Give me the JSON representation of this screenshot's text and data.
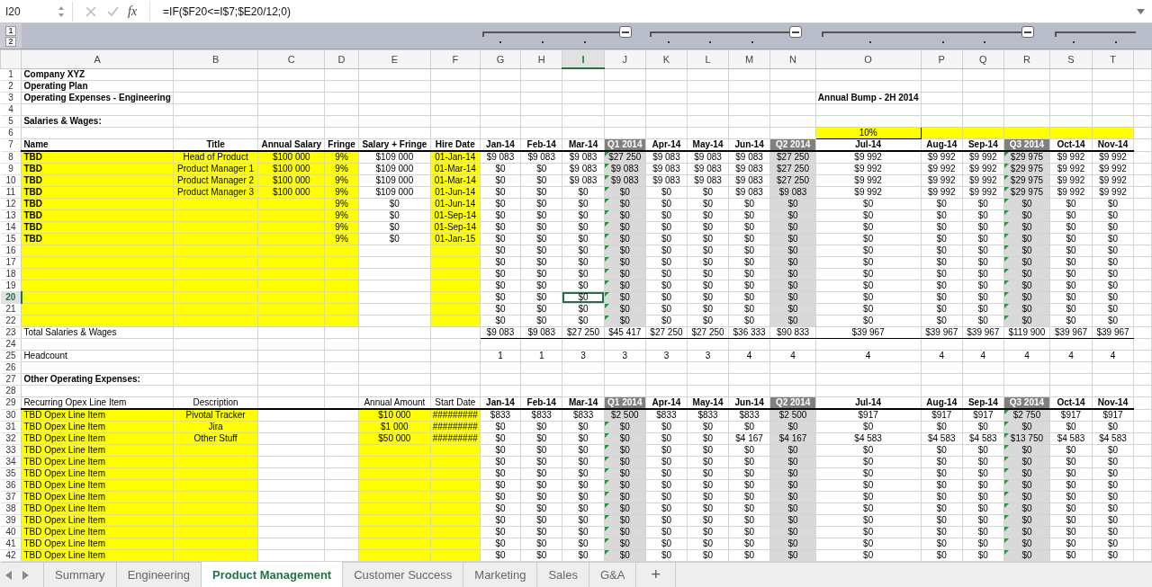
{
  "formula_bar": {
    "name_box": "I20",
    "fx": "fx",
    "formula": "=IF($F20<=I$7;$E20/12;0)"
  },
  "outline_levels": [
    "1",
    "2"
  ],
  "columns": [
    {
      "letter": "A",
      "kind": "label",
      "selected": false
    },
    {
      "letter": "B",
      "kind": "text",
      "selected": false
    },
    {
      "letter": "C",
      "kind": "text",
      "selected": false
    },
    {
      "letter": "D",
      "kind": "text",
      "selected": false
    },
    {
      "letter": "E",
      "kind": "text",
      "selected": false
    },
    {
      "letter": "F",
      "kind": "text",
      "selected": false
    },
    {
      "letter": "G",
      "kind": "month",
      "selected": false
    },
    {
      "letter": "H",
      "kind": "month",
      "selected": false
    },
    {
      "letter": "I",
      "kind": "month",
      "selected": true
    },
    {
      "letter": "J",
      "kind": "quarter",
      "selected": false
    },
    {
      "letter": "K",
      "kind": "month",
      "selected": false
    },
    {
      "letter": "L",
      "kind": "month",
      "selected": false
    },
    {
      "letter": "M",
      "kind": "month",
      "selected": false
    },
    {
      "letter": "N",
      "kind": "quarter",
      "selected": false
    },
    {
      "letter": "O",
      "kind": "month",
      "selected": false
    },
    {
      "letter": "P",
      "kind": "month",
      "selected": false
    },
    {
      "letter": "Q",
      "kind": "month",
      "selected": false
    },
    {
      "letter": "R",
      "kind": "quarter",
      "selected": false
    },
    {
      "letter": "S",
      "kind": "month",
      "selected": false
    },
    {
      "letter": "T",
      "kind": "month",
      "selected": false
    }
  ],
  "rows": [
    {
      "n": "1",
      "kind": "title",
      "selected": false,
      "cells": [
        "Company XYZ"
      ]
    },
    {
      "n": "2",
      "kind": "title",
      "selected": false,
      "cells": [
        "Operating Plan"
      ]
    },
    {
      "n": "3",
      "kind": "title",
      "selected": false,
      "cells": [
        "Operating Expenses - Engineering",
        null,
        null,
        null,
        null,
        null,
        null,
        null,
        null,
        null,
        null,
        null,
        null,
        null,
        "Annual Bump - 2H 2014"
      ]
    },
    {
      "n": "4",
      "kind": "plain",
      "selected": false
    },
    {
      "n": "5",
      "kind": "title",
      "selected": false,
      "cells": [
        "Salaries & Wages:"
      ]
    },
    {
      "n": "6",
      "kind": "bump",
      "selected": false,
      "cells": [
        null,
        null,
        null,
        null,
        null,
        null,
        null,
        null,
        null,
        null,
        null,
        null,
        null,
        null,
        "10%"
      ]
    },
    {
      "n": "7",
      "kind": "header",
      "selected": false,
      "cells": [
        "Name",
        "Title",
        "Annual Salary",
        "Fringe",
        "Salary + Fringe",
        "Hire Date",
        "Jan-14",
        "Feb-14",
        "Mar-14",
        "Q1 2014",
        "Apr-14",
        "May-14",
        "Jun-14",
        "Q2 2014",
        "Jul-14",
        "Aug-14",
        "Sep-14",
        "Q3 2014",
        "Oct-14",
        "Nov-14"
      ]
    },
    {
      "n": "8",
      "kind": "employee",
      "selected": false,
      "flagged_quarters": [
        true,
        false,
        true
      ],
      "cells": [
        "TBD",
        "Head of Product",
        "$100 000",
        "9%",
        "$109 000",
        "01-Jan-14",
        "$9 083",
        "$9 083",
        "$9 083",
        "$27 250",
        "$9 083",
        "$9 083",
        "$9 083",
        "$27 250",
        "$9 992",
        "$9 992",
        "$9 992",
        "$29 975",
        "$9 992",
        "$9 992"
      ]
    },
    {
      "n": "9",
      "kind": "employee",
      "selected": false,
      "flagged_quarters": [
        true,
        false,
        true
      ],
      "cells": [
        "TBD",
        "Product Manager 1",
        "$100 000",
        "9%",
        "$109 000",
        "01-Mar-14",
        "$0",
        "$0",
        "$9 083",
        "$9 083",
        "$9 083",
        "$9 083",
        "$9 083",
        "$27 250",
        "$9 992",
        "$9 992",
        "$9 992",
        "$29 975",
        "$9 992",
        "$9 992"
      ]
    },
    {
      "n": "10",
      "kind": "employee",
      "selected": false,
      "flagged_quarters": [
        true,
        false,
        true
      ],
      "cells": [
        "TBD",
        "Product Manager 2",
        "$100 000",
        "9%",
        "$109 000",
        "01-Mar-14",
        "$0",
        "$0",
        "$9 083",
        "$9 083",
        "$9 083",
        "$9 083",
        "$9 083",
        "$27 250",
        "$9 992",
        "$9 992",
        "$9 992",
        "$29 975",
        "$9 992",
        "$9 992"
      ]
    },
    {
      "n": "11",
      "kind": "employee",
      "selected": false,
      "flagged_quarters": [
        true,
        false,
        true
      ],
      "cells": [
        "TBD",
        "Product Manager 3",
        "$100 000",
        "9%",
        "$109 000",
        "01-Jun-14",
        "$0",
        "$0",
        "$0",
        "$0",
        "$0",
        "$0",
        "$9 083",
        "$9 083",
        "$9 992",
        "$9 992",
        "$9 992",
        "$29 975",
        "$9 992",
        "$9 992"
      ]
    },
    {
      "n": "12",
      "kind": "employee",
      "selected": false,
      "flagged_quarters": [
        true,
        false,
        true
      ],
      "cells": [
        "TBD",
        null,
        null,
        "9%",
        "$0",
        "01-Jun-14",
        "$0",
        "$0",
        "$0",
        "$0",
        "$0",
        "$0",
        "$0",
        "$0",
        "$0",
        "$0",
        "$0",
        "$0",
        "$0",
        "$0"
      ]
    },
    {
      "n": "13",
      "kind": "employee",
      "selected": false,
      "flagged_quarters": [
        true,
        false,
        true
      ],
      "cells": [
        "TBD",
        null,
        null,
        "9%",
        "$0",
        "01-Sep-14",
        "$0",
        "$0",
        "$0",
        "$0",
        "$0",
        "$0",
        "$0",
        "$0",
        "$0",
        "$0",
        "$0",
        "$0",
        "$0",
        "$0"
      ]
    },
    {
      "n": "14",
      "kind": "employee",
      "selected": false,
      "flagged_quarters": [
        true,
        false,
        true
      ],
      "cells": [
        "TBD",
        null,
        null,
        "9%",
        "$0",
        "01-Sep-14",
        "$0",
        "$0",
        "$0",
        "$0",
        "$0",
        "$0",
        "$0",
        "$0",
        "$0",
        "$0",
        "$0",
        "$0",
        "$0",
        "$0"
      ]
    },
    {
      "n": "15",
      "kind": "employee",
      "selected": false,
      "flagged_quarters": [
        true,
        false,
        true
      ],
      "cells": [
        "TBD",
        null,
        null,
        "9%",
        "$0",
        "01-Jan-15",
        "$0",
        "$0",
        "$0",
        "$0",
        "$0",
        "$0",
        "$0",
        "$0",
        "$0",
        "$0",
        "$0",
        "$0",
        "$0",
        "$0"
      ]
    },
    {
      "n": "16",
      "kind": "employee",
      "selected": false,
      "flagged_quarters": [
        true,
        false,
        true
      ],
      "cells": [
        null,
        null,
        null,
        null,
        null,
        null,
        "$0",
        "$0",
        "$0",
        "$0",
        "$0",
        "$0",
        "$0",
        "$0",
        "$0",
        "$0",
        "$0",
        "$0",
        "$0",
        "$0"
      ]
    },
    {
      "n": "17",
      "kind": "employee",
      "selected": false,
      "flagged_quarters": [
        true,
        false,
        true
      ],
      "cells": [
        null,
        null,
        null,
        null,
        null,
        null,
        "$0",
        "$0",
        "$0",
        "$0",
        "$0",
        "$0",
        "$0",
        "$0",
        "$0",
        "$0",
        "$0",
        "$0",
        "$0",
        "$0"
      ]
    },
    {
      "n": "18",
      "kind": "employee",
      "selected": false,
      "flagged_quarters": [
        true,
        false,
        true
      ],
      "cells": [
        null,
        null,
        null,
        null,
        null,
        null,
        "$0",
        "$0",
        "$0",
        "$0",
        "$0",
        "$0",
        "$0",
        "$0",
        "$0",
        "$0",
        "$0",
        "$0",
        "$0",
        "$0"
      ]
    },
    {
      "n": "19",
      "kind": "employee",
      "selected": false,
      "flagged_quarters": [
        true,
        false,
        true
      ],
      "cells": [
        null,
        null,
        null,
        null,
        null,
        null,
        "$0",
        "$0",
        "$0",
        "$0",
        "$0",
        "$0",
        "$0",
        "$0",
        "$0",
        "$0",
        "$0",
        "$0",
        "$0",
        "$0"
      ]
    },
    {
      "n": "20",
      "kind": "employee",
      "selected": true,
      "flagged_quarters": [
        true,
        false,
        true
      ],
      "cells": [
        null,
        null,
        null,
        null,
        null,
        null,
        "$0",
        "$0",
        "$0",
        "$0",
        "$0",
        "$0",
        "$0",
        "$0",
        "$0",
        "$0",
        "$0",
        "$0",
        "$0",
        "$0"
      ]
    },
    {
      "n": "21",
      "kind": "employee",
      "selected": false,
      "flagged_quarters": [
        true,
        false,
        true
      ],
      "cells": [
        null,
        null,
        null,
        null,
        null,
        null,
        "$0",
        "$0",
        "$0",
        "$0",
        "$0",
        "$0",
        "$0",
        "$0",
        "$0",
        "$0",
        "$0",
        "$0",
        "$0",
        "$0"
      ]
    },
    {
      "n": "22",
      "kind": "employee",
      "selected": false,
      "flagged_quarters": [
        true,
        false,
        true
      ],
      "cells": [
        null,
        null,
        null,
        null,
        null,
        null,
        "$0",
        "$0",
        "$0",
        "$0",
        "$0",
        "$0",
        "$0",
        "$0",
        "$0",
        "$0",
        "$0",
        "$0",
        "$0",
        "$0"
      ]
    },
    {
      "n": "23",
      "kind": "total",
      "selected": false,
      "cells": [
        "Total Salaries & Wages",
        null,
        null,
        null,
        null,
        null,
        "$9 083",
        "$9 083",
        "$27 250",
        "$45 417",
        "$27 250",
        "$27 250",
        "$36 333",
        "$90 833",
        "$39 967",
        "$39 967",
        "$39 967",
        "$119 900",
        "$39 967",
        "$39 967"
      ]
    },
    {
      "n": "24",
      "kind": "plain",
      "selected": false
    },
    {
      "n": "25",
      "kind": "plain",
      "selected": false,
      "cells": [
        "Headcount",
        null,
        null,
        null,
        null,
        null,
        "1",
        "1",
        "3",
        "3",
        "3",
        "3",
        "4",
        "4",
        "4",
        "4",
        "4",
        "4",
        "4",
        "4"
      ]
    },
    {
      "n": "26",
      "kind": "plain",
      "selected": false
    },
    {
      "n": "27",
      "kind": "title",
      "selected": false,
      "cells": [
        "Other Operating Expenses:"
      ]
    },
    {
      "n": "28",
      "kind": "plain",
      "selected": false
    },
    {
      "n": "29",
      "kind": "opex_header",
      "selected": false,
      "cells": [
        "Recurring Opex Line Item",
        "Description",
        null,
        null,
        "Annual Amount",
        "Start Date",
        "Jan-14",
        "Feb-14",
        "Mar-14",
        "Q1 2014",
        "Apr-14",
        "May-14",
        "Jun-14",
        "Q2 2014",
        "Jul-14",
        "Aug-14",
        "Sep-14",
        "Q3 2014",
        "Oct-14",
        "Nov-14"
      ]
    },
    {
      "n": "30",
      "kind": "opex",
      "selected": false,
      "flagged_quarters": [
        false,
        false,
        true
      ],
      "cells": [
        "TBD Opex Line Item",
        "Pivotal Tracker",
        null,
        null,
        "$10 000",
        "#########",
        "$833",
        "$833",
        "$833",
        "$2 500",
        "$833",
        "$833",
        "$833",
        "$2 500",
        "$917",
        "$917",
        "$917",
        "$2 750",
        "$917",
        "$917"
      ]
    },
    {
      "n": "31",
      "kind": "opex",
      "selected": false,
      "flagged_quarters": [
        true,
        false,
        true
      ],
      "cells": [
        "TBD Opex Line Item",
        "Jira",
        null,
        null,
        "$1 000",
        "#########",
        "$0",
        "$0",
        "$0",
        "$0",
        "$0",
        "$0",
        "$0",
        "$0",
        "$0",
        "$0",
        "$0",
        "$0",
        "$0",
        "$0"
      ]
    },
    {
      "n": "32",
      "kind": "opex",
      "selected": false,
      "flagged_quarters": [
        true,
        false,
        true
      ],
      "cells": [
        "TBD Opex Line Item",
        "Other Stuff",
        null,
        null,
        "$50 000",
        "#########",
        "$0",
        "$0",
        "$0",
        "$0",
        "$0",
        "$0",
        "$4 167",
        "$4 167",
        "$4 583",
        "$4 583",
        "$4 583",
        "$13 750",
        "$4 583",
        "$4 583"
      ]
    },
    {
      "n": "33",
      "kind": "opex",
      "selected": false,
      "flagged_quarters": [
        true,
        false,
        true
      ],
      "cells": [
        "TBD Opex Line Item",
        null,
        null,
        null,
        null,
        null,
        "$0",
        "$0",
        "$0",
        "$0",
        "$0",
        "$0",
        "$0",
        "$0",
        "$0",
        "$0",
        "$0",
        "$0",
        "$0",
        "$0"
      ]
    },
    {
      "n": "34",
      "kind": "opex",
      "selected": false,
      "flagged_quarters": [
        true,
        false,
        true
      ],
      "cells": [
        "TBD Opex Line Item",
        null,
        null,
        null,
        null,
        null,
        "$0",
        "$0",
        "$0",
        "$0",
        "$0",
        "$0",
        "$0",
        "$0",
        "$0",
        "$0",
        "$0",
        "$0",
        "$0",
        "$0"
      ]
    },
    {
      "n": "35",
      "kind": "opex",
      "selected": false,
      "flagged_quarters": [
        true,
        false,
        true
      ],
      "cells": [
        "TBD Opex Line Item",
        null,
        null,
        null,
        null,
        null,
        "$0",
        "$0",
        "$0",
        "$0",
        "$0",
        "$0",
        "$0",
        "$0",
        "$0",
        "$0",
        "$0",
        "$0",
        "$0",
        "$0"
      ]
    },
    {
      "n": "36",
      "kind": "opex",
      "selected": false,
      "flagged_quarters": [
        true,
        false,
        true
      ],
      "cells": [
        "TBD Opex Line Item",
        null,
        null,
        null,
        null,
        null,
        "$0",
        "$0",
        "$0",
        "$0",
        "$0",
        "$0",
        "$0",
        "$0",
        "$0",
        "$0",
        "$0",
        "$0",
        "$0",
        "$0"
      ]
    },
    {
      "n": "37",
      "kind": "opex",
      "selected": false,
      "flagged_quarters": [
        true,
        false,
        true
      ],
      "cells": [
        "TBD Opex Line Item",
        null,
        null,
        null,
        null,
        null,
        "$0",
        "$0",
        "$0",
        "$0",
        "$0",
        "$0",
        "$0",
        "$0",
        "$0",
        "$0",
        "$0",
        "$0",
        "$0",
        "$0"
      ]
    },
    {
      "n": "38",
      "kind": "opex",
      "selected": false,
      "flagged_quarters": [
        true,
        false,
        true
      ],
      "cells": [
        "TBD Opex Line Item",
        null,
        null,
        null,
        null,
        null,
        "$0",
        "$0",
        "$0",
        "$0",
        "$0",
        "$0",
        "$0",
        "$0",
        "$0",
        "$0",
        "$0",
        "$0",
        "$0",
        "$0"
      ]
    },
    {
      "n": "39",
      "kind": "opex",
      "selected": false,
      "flagged_quarters": [
        true,
        false,
        true
      ],
      "cells": [
        "TBD Opex Line Item",
        null,
        null,
        null,
        null,
        null,
        "$0",
        "$0",
        "$0",
        "$0",
        "$0",
        "$0",
        "$0",
        "$0",
        "$0",
        "$0",
        "$0",
        "$0",
        "$0",
        "$0"
      ]
    },
    {
      "n": "40",
      "kind": "opex",
      "selected": false,
      "flagged_quarters": [
        true,
        false,
        true
      ],
      "cells": [
        "TBD Opex Line Item",
        null,
        null,
        null,
        null,
        null,
        "$0",
        "$0",
        "$0",
        "$0",
        "$0",
        "$0",
        "$0",
        "$0",
        "$0",
        "$0",
        "$0",
        "$0",
        "$0",
        "$0"
      ]
    },
    {
      "n": "41",
      "kind": "opex",
      "selected": false,
      "flagged_quarters": [
        true,
        false,
        true
      ],
      "cells": [
        "TBD Opex Line Item",
        null,
        null,
        null,
        null,
        null,
        "$0",
        "$0",
        "$0",
        "$0",
        "$0",
        "$0",
        "$0",
        "$0",
        "$0",
        "$0",
        "$0",
        "$0",
        "$0",
        "$0"
      ]
    },
    {
      "n": "42",
      "kind": "opex",
      "selected": false,
      "flagged_quarters": [
        true,
        false,
        true
      ],
      "cells": [
        "TBD Opex Line Item",
        null,
        null,
        null,
        null,
        null,
        "$0",
        "$0",
        "$0",
        "$0",
        "$0",
        "$0",
        "$0",
        "$0",
        "$0",
        "$0",
        "$0",
        "$0",
        "$0",
        "$0"
      ]
    }
  ],
  "sheet_tabs": [
    {
      "label": "Summary",
      "selected": false
    },
    {
      "label": "Engineering",
      "selected": false
    },
    {
      "label": "Product Management",
      "selected": true
    },
    {
      "label": "Customer Success",
      "selected": false
    },
    {
      "label": "Marketing",
      "selected": false
    },
    {
      "label": "Sales",
      "selected": false
    },
    {
      "label": "G&A",
      "selected": false
    }
  ],
  "add_sheet": "+"
}
